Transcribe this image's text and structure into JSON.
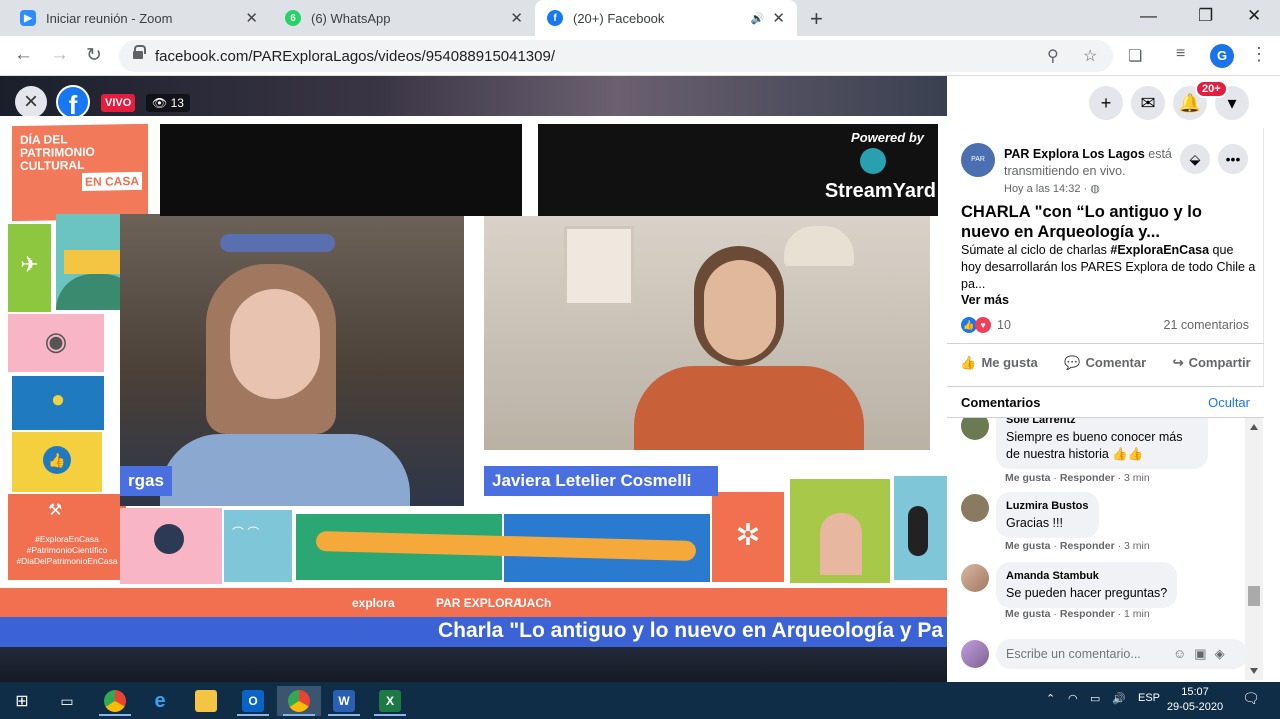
{
  "browser": {
    "tabs": [
      {
        "title": "Iniciar reunión - Zoom",
        "icon": "zoom-icon",
        "color": "#2d8cff"
      },
      {
        "title": "(6) WhatsApp",
        "icon": "whatsapp-icon",
        "color": "#25d366",
        "favtext": "6"
      },
      {
        "title": "(20+) Facebook",
        "icon": "facebook-icon",
        "color": "#1877f2"
      }
    ],
    "url": "facebook.com/PARExploraLagos/videos/954088915041309/",
    "profile_initial": "G"
  },
  "video": {
    "live_label": "VIVO",
    "viewers": "13",
    "dia_title": "DÍA DEL\nPATRIMONIO\nCULTURAL",
    "en_casa": "EN CASA",
    "powered_by": "Powered by",
    "streamyard": "StreamYard",
    "speaker1": "rgas",
    "speaker2": "Javiera Letelier Cosmelli",
    "hashtags": "#ExploraEnCasa\n#PatrimonioCientífico\n#DiaDelPatrimonioEnCasa",
    "logo1": "explora",
    "logo2": "PAR EXPLORA",
    "logo3": "UACh",
    "ticker": "Charla \"Lo antiguo y lo nuevo en Arqueología y Pa"
  },
  "side": {
    "notif_badge": "20+",
    "page_name": "PAR Explora Los Lagos",
    "page_action": "está transmitiendo en vivo.",
    "time": "Hoy a las 14:32 ·",
    "avatar_text": "PAR EXPLORA",
    "title": "CHARLA \"con “Lo antiguo y lo nuevo en Arqueología y...",
    "desc_pre": "Súmate al ciclo de charlas ",
    "desc_tag": "#ExploraEnCasa",
    "desc_post": " que hoy desarrollarán los PARES Explora de todo Chile a pa...",
    "see_more": "Ver más",
    "reactions": "10",
    "comment_count": "21 comentarios",
    "like": "Me gusta",
    "comment": "Comentar",
    "share": "Compartir",
    "comments_title": "Comentarios",
    "hide": "Ocultar",
    "comments": [
      {
        "name": "Sole Larrentz",
        "text": "Siempre es bueno conocer más de nuestra historia 👍👍",
        "meta_like": "Me gusta",
        "meta_reply": "Responder",
        "meta_time": "3 min"
      },
      {
        "name": "Luzmira Bustos",
        "text": "Gracias !!!",
        "meta_like": "Me gusta",
        "meta_reply": "Responder",
        "meta_time": "3 min"
      },
      {
        "name": "Amanda Stambuk",
        "text": "Se pueden hacer preguntas?",
        "meta_like": "Me gusta",
        "meta_reply": "Responder",
        "meta_time": "1 min"
      }
    ],
    "write_placeholder": "Escribe un comentario..."
  },
  "taskbar": {
    "lang": "ESP",
    "time": "15:07",
    "date": "29-05-2020"
  }
}
